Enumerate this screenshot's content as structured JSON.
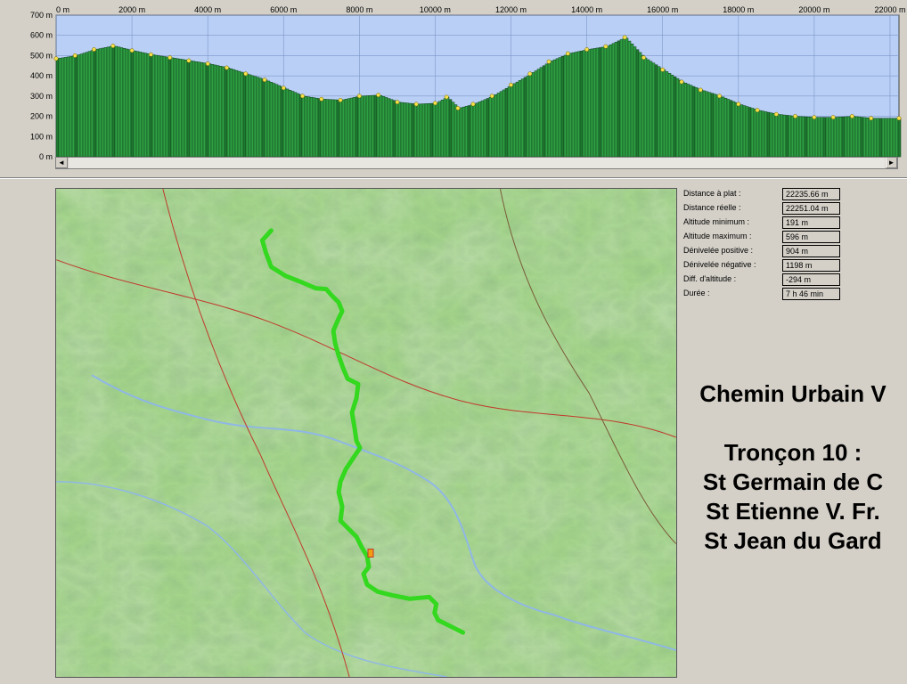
{
  "profile": {
    "x_ticks": [
      "0 m",
      "2000 m",
      "4000 m",
      "6000 m",
      "8000 m",
      "10000 m",
      "12000 m",
      "14000 m",
      "16000 m",
      "18000 m",
      "20000 m",
      "22000 m"
    ],
    "y_ticks": [
      "700 m",
      "600 m",
      "500 m",
      "400 m",
      "300 m",
      "200 m",
      "100 m",
      "0 m"
    ]
  },
  "chart_data": {
    "type": "area",
    "xlim": [
      0,
      22236
    ],
    "ylim": [
      0,
      700
    ],
    "x_ticks": [
      0,
      2000,
      4000,
      6000,
      8000,
      10000,
      12000,
      14000,
      16000,
      18000,
      20000,
      22000
    ],
    "y_ticks": [
      700,
      600,
      500,
      400,
      300,
      200,
      100,
      0
    ],
    "series": [
      {
        "x": [
          0,
          500,
          1000,
          1500,
          2000,
          2500,
          3000,
          3500,
          4000,
          4500,
          5000,
          5500,
          6000,
          6500,
          7000,
          7500,
          8000,
          8500,
          9000,
          9500,
          10000,
          10300,
          10600,
          11000,
          11500,
          12000,
          12500,
          13000,
          13500,
          14000,
          14500,
          15000,
          15500,
          16000,
          16500,
          17000,
          17500,
          18000,
          18500,
          19000,
          19500,
          20000,
          20500,
          21000,
          21500,
          22236
        ],
        "y": [
          485,
          500,
          530,
          548,
          525,
          505,
          490,
          475,
          460,
          440,
          410,
          380,
          340,
          300,
          285,
          280,
          300,
          305,
          270,
          260,
          265,
          295,
          240,
          260,
          300,
          355,
          410,
          470,
          510,
          530,
          545,
          590,
          490,
          430,
          370,
          330,
          300,
          260,
          230,
          210,
          200,
          195,
          195,
          200,
          190,
          190
        ]
      }
    ],
    "grid": true
  },
  "stats": [
    {
      "label": "Distance à plat :",
      "value": "22235.66 m"
    },
    {
      "label": "Distance réelle :",
      "value": "22251.04 m"
    },
    {
      "label": "Altitude minimum :",
      "value": "191 m"
    },
    {
      "label": "Altitude maximum :",
      "value": "596 m"
    },
    {
      "label": "Dénivelée positive :",
      "value": "904 m"
    },
    {
      "label": "Dénivelée négative :",
      "value": "1198 m"
    },
    {
      "label": "Diff. d'altitude :",
      "value": "-294 m"
    },
    {
      "label": "Durée :",
      "value": "7 h 46 min"
    }
  ],
  "title": {
    "line1": "Chemin Urbain V",
    "line2": "Tronçon 10 :",
    "line3": "St Germain de C",
    "line4": "St Etienne V. Fr.",
    "line5": "St Jean du Gard"
  },
  "colors": {
    "sky": "#b9cff6",
    "bars": "#2ea043",
    "bars_dark": "#1e7a30",
    "route": "#3ddc2a",
    "map_bg": "#9ccf7a"
  },
  "icons": {
    "scroll_left": "◄",
    "scroll_right": "►"
  }
}
